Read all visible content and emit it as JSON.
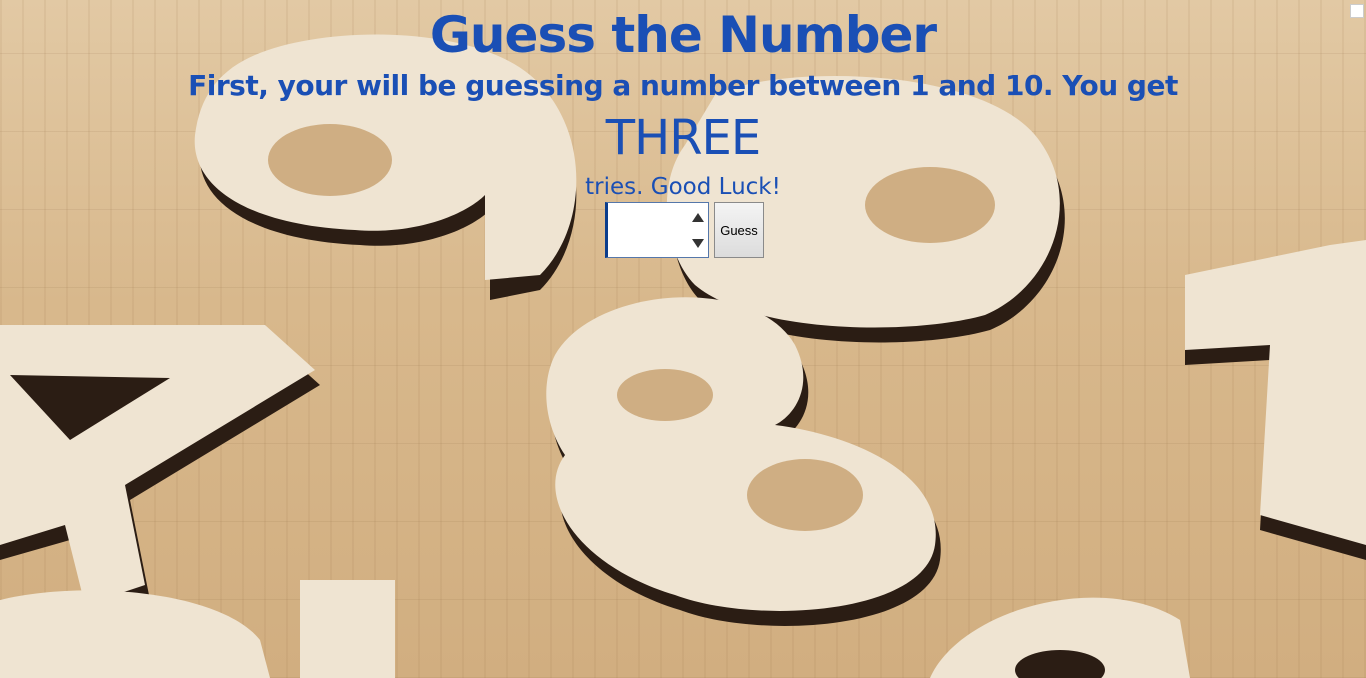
{
  "page": {
    "title": "Guess the Number",
    "instructions_line1": "First, your will be guessing a number between 1 and 10. You get",
    "emphasis": "THREE",
    "instructions_line2": "tries. Good Luck!"
  },
  "form": {
    "guess_input_value": "",
    "guess_button_label": "Guess"
  },
  "colors": {
    "text_blue": "#1a4fb5",
    "background_wood": "#d9b98f"
  }
}
